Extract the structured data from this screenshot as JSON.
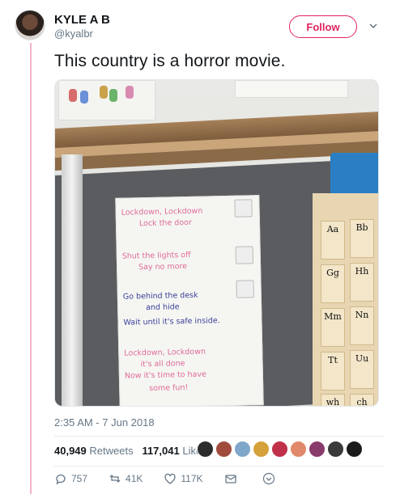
{
  "author": {
    "name": "KYLE A B",
    "handle": "@kyalbr",
    "follow_label": "Follow"
  },
  "tweet": {
    "text": "This country is a horror movie.",
    "timestamp": "2:35 AM - 7 Jun 2018"
  },
  "photo": {
    "poster_lines": [
      "Lockdown, Lockdown",
      "Lock the door",
      "Shut the lights off",
      "Say no more",
      "Go behind the desk",
      "and hide",
      "Wait until it's safe inside.",
      "Lockdown, Lockdown",
      "it's all done",
      "Now it's time to have",
      "some fun!"
    ],
    "alphabet_cards": [
      "Aa",
      "Bb",
      "Gg",
      "Hh",
      "Mm",
      "Nn",
      "Tt",
      "Uu",
      "wh",
      "ch"
    ]
  },
  "stats": {
    "retweets_count": "40,949",
    "retweets_label": "Retweets",
    "likes_count": "117,041",
    "likes_label": "Likes"
  },
  "likers": [
    {
      "color": "#2c2c2c"
    },
    {
      "color": "#a04b3c"
    },
    {
      "color": "#7fa7c9"
    },
    {
      "color": "#d4a13a"
    },
    {
      "color": "#c0304a"
    },
    {
      "color": "#e08a6b"
    },
    {
      "color": "#8a3b6d"
    },
    {
      "color": "#3a3a3a"
    },
    {
      "color": "#1b1b1b"
    }
  ],
  "actions": {
    "replies": "757",
    "retweets": "41K",
    "likes": "117K"
  },
  "colors": {
    "accent": "#e0245e",
    "muted": "#657786"
  }
}
